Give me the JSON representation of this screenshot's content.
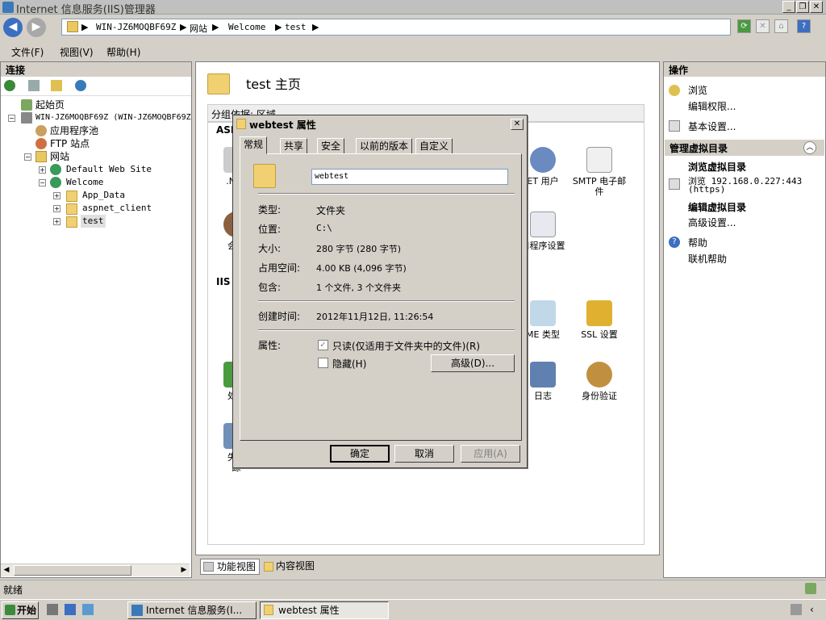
{
  "window": {
    "title": "Internet 信息服务(IIS)管理器"
  },
  "address": {
    "parts": [
      "WIN-JZ6MOQBF69Z",
      "网站",
      "Welcome",
      "test"
    ]
  },
  "menu": {
    "file": "文件(F)",
    "view": "视图(V)",
    "help": "帮助(H)"
  },
  "connections": {
    "header": "连接",
    "tree": [
      {
        "label": "起始页",
        "icon": "home-page-icon"
      },
      {
        "label": "WIN-JZ6MOQBF69Z (WIN-JZ6MOQBF69Z",
        "icon": "server-icon"
      },
      {
        "label": "应用程序池",
        "icon": "app-pool-icon"
      },
      {
        "label": "FTP 站点",
        "icon": "ftp-icon"
      },
      {
        "label": "网站",
        "icon": "sites-folder-icon"
      },
      {
        "label": "Default Web Site",
        "icon": "globe-icon"
      },
      {
        "label": "Welcome",
        "icon": "globe-icon"
      },
      {
        "label": "App_Data",
        "icon": "folder-icon"
      },
      {
        "label": "aspnet_client",
        "icon": "folder-icon"
      },
      {
        "label": "test",
        "icon": "folder-icon"
      }
    ]
  },
  "main": {
    "title": "test 主页",
    "group_label": "分组依据: 区域",
    "section_asp": "ASP",
    "section_iis": "IIS",
    "features": [
      {
        "label": ".NET",
        "icon": "net-icon"
      },
      {
        "label": "ET 用户",
        "icon": "users-icon"
      },
      {
        "label": "SMTP 电子邮件",
        "icon": "smtp-mail-icon"
      },
      {
        "label": "会话",
        "icon": "session-icon"
      },
      {
        "label": "用程序设置",
        "icon": "app-settings-icon"
      },
      {
        "label": "ME 类型",
        "icon": "mime-icon"
      },
      {
        "label": "SSL 设置",
        "icon": "ssl-lock-icon"
      },
      {
        "label": "处理",
        "icon": "handler-icon"
      },
      {
        "label": "日志",
        "icon": "log-icon"
      },
      {
        "label": "身份验证",
        "icon": "auth-icon"
      },
      {
        "label": "失败",
        "icon": "failed-icon"
      },
      {
        "label": "踪",
        "icon": "trace-icon"
      }
    ],
    "tabs": {
      "features": "功能视图",
      "content": "内容视图"
    }
  },
  "actions": {
    "header": "操作",
    "browse": "浏览",
    "edit_perms": "编辑权限...",
    "basic_settings": "基本设置...",
    "manage_vdir": "管理虚拟目录",
    "browse_vdir_title": "浏览虚拟目录",
    "browse_link": "浏览 192.168.0.227:443",
    "browse_link_sub": "(https)",
    "edit_vdir": "编辑虚拟目录",
    "advanced": "高级设置...",
    "help_title": "帮助",
    "online_help": "联机帮助"
  },
  "status": {
    "text": "就绪"
  },
  "taskbar": {
    "start": "开始",
    "task1": "Internet 信息服务(I...",
    "task2": "webtest 属性"
  },
  "dialog": {
    "title": "webtest 属性",
    "tabs": [
      "常规",
      "共享",
      "安全",
      "以前的版本",
      "自定义"
    ],
    "name_value": "webtest",
    "type_label": "类型:",
    "type_value": "文件夹",
    "location_label": "位置:",
    "location_value": "C:\\",
    "size_label": "大小:",
    "size_value": "280 字节 (280 字节)",
    "disk_label": "占用空间:",
    "disk_value": "4.00 KB (4,096 字节)",
    "contains_label": "包含:",
    "contains_value": "1 个文件, 3 个文件夹",
    "created_label": "创建时间:",
    "created_value": "2012年11月12日, 11:26:54",
    "attr_label": "属性:",
    "readonly_label": "只读(仅适用于文件夹中的文件)(R)",
    "readonly_checked": true,
    "hidden_label": "隐藏(H)",
    "advanced_btn": "高级(D)...",
    "ok": "确定",
    "cancel": "取消",
    "apply": "应用(A)"
  }
}
